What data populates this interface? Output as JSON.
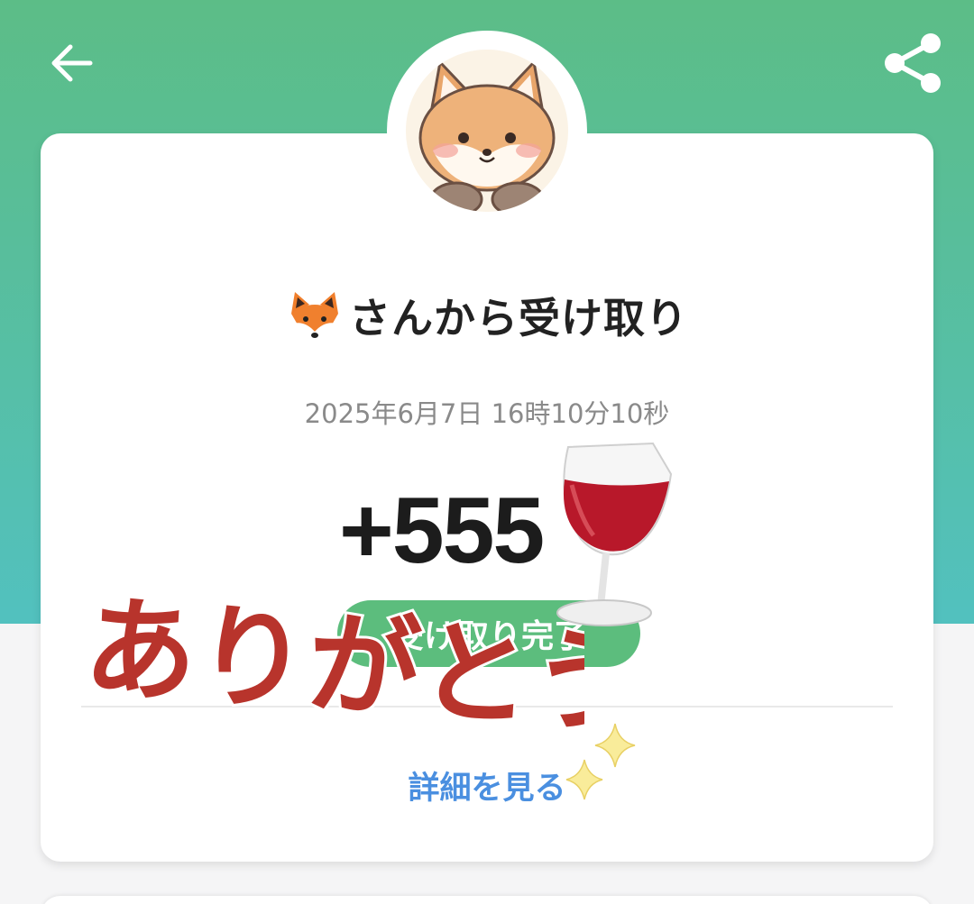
{
  "header": {
    "back_icon": "arrow-left-icon",
    "share_icon": "share-icon",
    "background_colors": [
      "#5cbd87",
      "#52c1bf"
    ]
  },
  "profile": {
    "avatar": "fox-avatar"
  },
  "transaction": {
    "sender_emoji": "🦊",
    "sender_text": "さんから受け取り",
    "datetime": "2025年6月7日 16時10分10秒",
    "amount": "+555",
    "status": "受け取り完了",
    "status_color": "#5cbd7d"
  },
  "details": {
    "link_text": "詳細を見る",
    "link_color": "#4a8fe0"
  },
  "stickers": {
    "thanks_text": "ありがとう",
    "thanks_color": "#b8342c",
    "wine_icon": "wine-glass-icon",
    "sparkles_icon": "sparkles-icon"
  }
}
